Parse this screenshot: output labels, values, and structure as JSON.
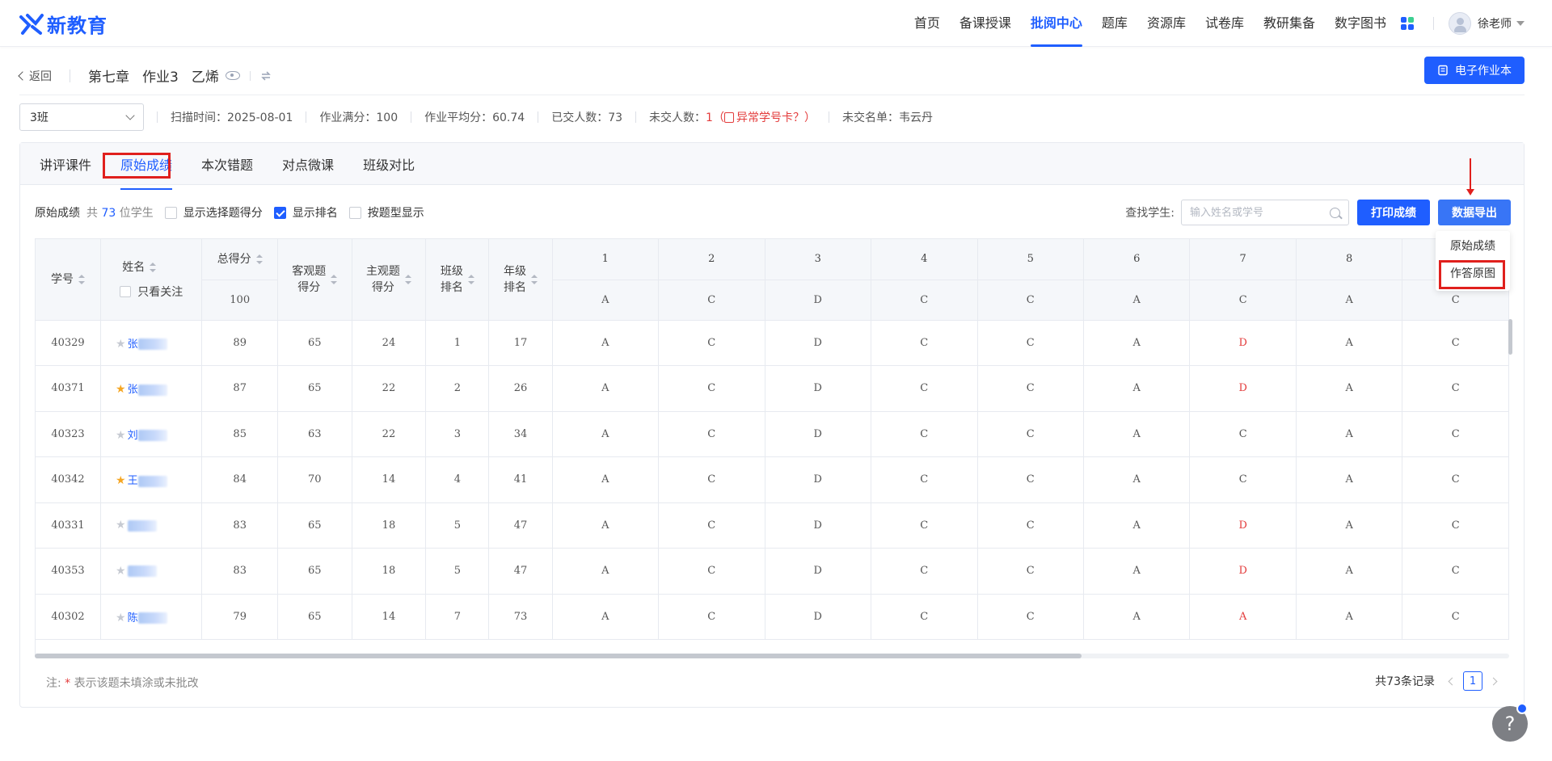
{
  "brand": {
    "name": "新教育",
    "color": "#1f5eff"
  },
  "nav": {
    "items": [
      "首页",
      "备课授课",
      "批阅中心",
      "题库",
      "资源库",
      "试卷库",
      "教研集备",
      "数字图书"
    ],
    "active_index": 2,
    "user_name": "徐老师"
  },
  "subheader": {
    "back_label": "返回",
    "chapter": "第七章",
    "homework": "作业3",
    "topic": "乙烯",
    "ebook_button": "电子作业本"
  },
  "info": {
    "class_value": "3班",
    "scan_time_label": "扫描时间：",
    "scan_time": "2025-08-01",
    "full_score_label": "作业满分：",
    "full_score": "100",
    "avg_label": "作业平均分：",
    "avg": "60.74",
    "submitted_label": "已交人数：",
    "submitted": "73",
    "unsubmitted_label": "未交人数：",
    "unsubmitted": "1（",
    "abnormal_link": "异常学号卡？）",
    "unsubmitted_list_label": "未交名单：",
    "unsubmitted_list": "韦云丹"
  },
  "tabs": [
    "讲评课件",
    "原始成绩",
    "本次错题",
    "对点微课",
    "班级对比"
  ],
  "toolbar": {
    "title": "原始成绩",
    "count_prefix": "共",
    "count": "73",
    "count_suffix": "位学生",
    "opt_choice_score": "显示选择题得分",
    "opt_show_rank": "显示排名",
    "opt_by_type": "按题型显示",
    "search_label": "查找学生:",
    "search_placeholder": "输入姓名或学号",
    "print_button": "打印成绩",
    "export_button": "数据导出"
  },
  "export_menu": [
    "原始成绩",
    "作答原图"
  ],
  "table": {
    "headers": {
      "id": "学号",
      "name": "姓名",
      "focus_only": "只看关注",
      "total": "总得分",
      "total_full": "100",
      "objective_l1": "客观题",
      "objective_l2": "得分",
      "subjective_l1": "主观题",
      "subjective_l2": "得分",
      "class_rank_l1": "班级",
      "class_rank_l2": "排名",
      "grade_rank_l1": "年级",
      "grade_rank_l2": "排名"
    },
    "questions": [
      "1",
      "2",
      "3",
      "4",
      "5",
      "6",
      "7",
      "8",
      ""
    ],
    "answer_key": [
      "A",
      "C",
      "D",
      "C",
      "C",
      "A",
      "C",
      "A",
      "C"
    ],
    "rows": [
      {
        "id": "40329",
        "name": "张",
        "starred": false,
        "total": "89",
        "obj": "65",
        "subj": "24",
        "class_rank": "1",
        "grade_rank": "17",
        "answers": [
          "A",
          "C",
          "D",
          "C",
          "C",
          "A",
          "D",
          "A",
          "C"
        ]
      },
      {
        "id": "40371",
        "name": "张",
        "starred": true,
        "total": "87",
        "obj": "65",
        "subj": "22",
        "class_rank": "2",
        "grade_rank": "26",
        "answers": [
          "A",
          "C",
          "D",
          "C",
          "C",
          "A",
          "D",
          "A",
          "C"
        ]
      },
      {
        "id": "40323",
        "name": "刘",
        "starred": false,
        "total": "85",
        "obj": "63",
        "subj": "22",
        "class_rank": "3",
        "grade_rank": "34",
        "answers": [
          "A",
          "C",
          "D",
          "C",
          "C",
          "A",
          "C",
          "A",
          "C"
        ]
      },
      {
        "id": "40342",
        "name": "王",
        "starred": true,
        "total": "84",
        "obj": "70",
        "subj": "14",
        "class_rank": "4",
        "grade_rank": "41",
        "answers": [
          "A",
          "C",
          "D",
          "C",
          "C",
          "A",
          "C",
          "A",
          "C"
        ]
      },
      {
        "id": "40331",
        "name": "",
        "starred": false,
        "total": "83",
        "obj": "65",
        "subj": "18",
        "class_rank": "5",
        "grade_rank": "47",
        "answers": [
          "A",
          "C",
          "D",
          "C",
          "C",
          "A",
          "D",
          "A",
          "C"
        ]
      },
      {
        "id": "40353",
        "name": "",
        "starred": false,
        "total": "83",
        "obj": "65",
        "subj": "18",
        "class_rank": "5",
        "grade_rank": "47",
        "answers": [
          "A",
          "C",
          "D",
          "C",
          "C",
          "A",
          "D",
          "A",
          "C"
        ]
      },
      {
        "id": "40302",
        "name": "陈",
        "starred": false,
        "total": "79",
        "obj": "65",
        "subj": "14",
        "class_rank": "7",
        "grade_rank": "73",
        "answers": [
          "A",
          "C",
          "D",
          "C",
          "C",
          "A",
          "A",
          "A",
          "C"
        ]
      }
    ]
  },
  "footer": {
    "note_prefix": "注:",
    "note_star": "*",
    "note_text": "表示该题未填涂或未批改",
    "total_records": "共73条记录",
    "page": "1"
  },
  "help_label": "?",
  "colors": {
    "accent": "#1f5eff",
    "wrong": "#e33b3b",
    "annotation": "#e0201d"
  }
}
